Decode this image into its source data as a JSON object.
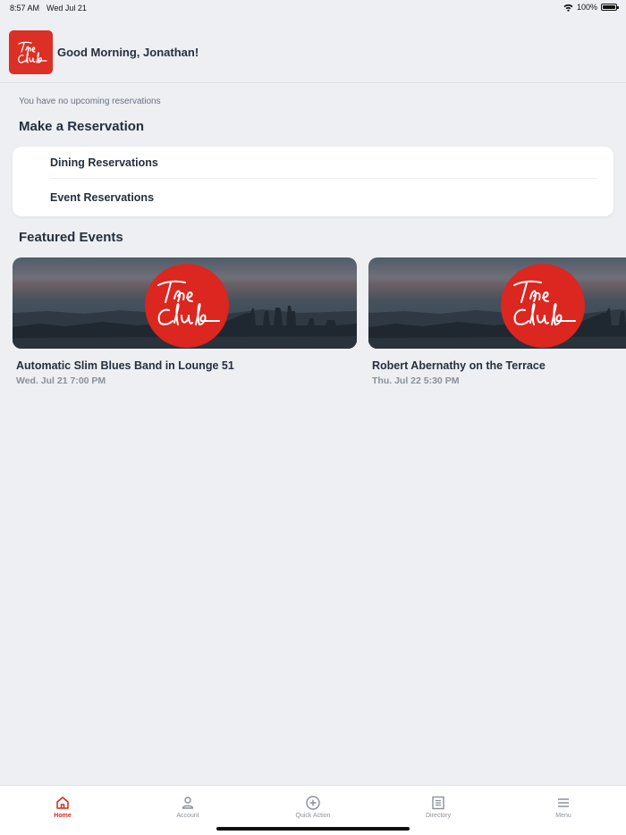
{
  "status_bar": {
    "time": "8:57 AM",
    "date": "Wed Jul 21",
    "battery": "100%",
    "icons": [
      "wifi-icon",
      "battery-icon"
    ]
  },
  "header": {
    "logo_text": "The Club",
    "greeting": "Good Morning, Jonathan!"
  },
  "reservations": {
    "empty_message": "You have no upcoming reservations",
    "section_title": "Make a Reservation",
    "items": [
      {
        "label": "Dining Reservations"
      },
      {
        "label": "Event Reservations"
      }
    ]
  },
  "featured": {
    "section_title": "Featured Events",
    "events": [
      {
        "title": "Automatic Slim Blues Band in Lounge 51",
        "date": "Wed. Jul 21 7:00 PM",
        "logo_text": "The Club"
      },
      {
        "title": "Robert Abernathy on the Terrace",
        "date": "Thu. Jul 22 5:30 PM",
        "logo_text": "The Club"
      }
    ]
  },
  "tab_bar": {
    "tabs": [
      {
        "label": "Home",
        "icon": "home-icon",
        "active": true
      },
      {
        "label": "Account",
        "icon": "person-icon",
        "active": false
      },
      {
        "label": "Quick Action",
        "icon": "plus-circle-icon",
        "active": false
      },
      {
        "label": "Directory",
        "icon": "list-icon",
        "active": false
      },
      {
        "label": "Menu",
        "icon": "hamburger-icon",
        "active": false
      }
    ]
  },
  "colors": {
    "brand_red": "#dc2f25",
    "active_tab": "#d5281f",
    "background": "#edeff3",
    "text_primary": "#26303d",
    "text_muted": "#8a909a"
  }
}
